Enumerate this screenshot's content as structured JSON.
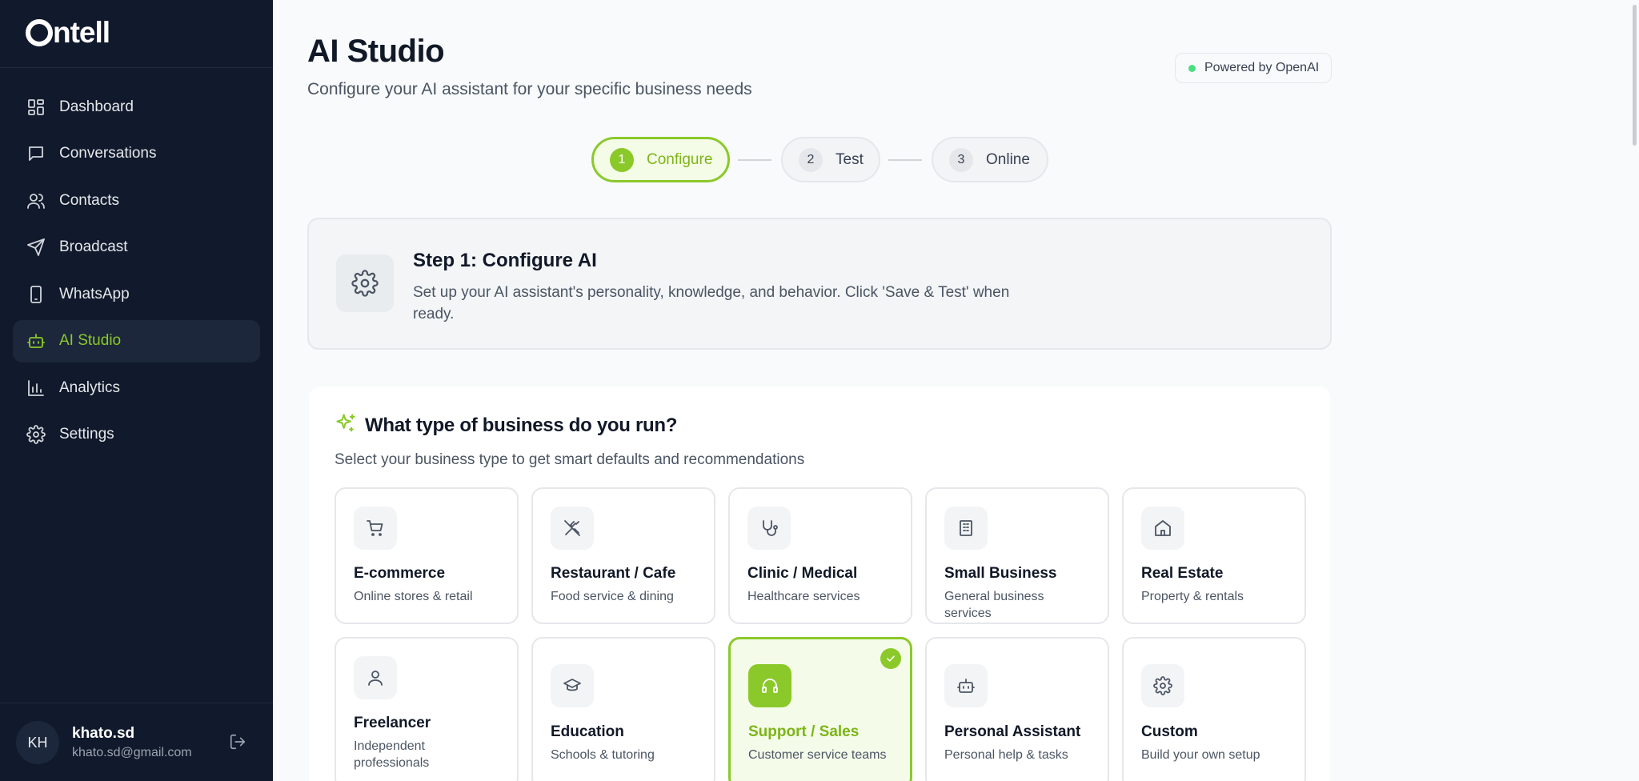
{
  "brand": {
    "name": "ntell",
    "accent": "#8bc92a",
    "sidebar_bg": "#111a2c"
  },
  "sidebar": {
    "items": [
      {
        "label": "Dashboard",
        "icon": "dashboard-icon",
        "active": false
      },
      {
        "label": "Conversations",
        "icon": "chat-bubble-icon",
        "active": false
      },
      {
        "label": "Contacts",
        "icon": "users-icon",
        "active": false
      },
      {
        "label": "Broadcast",
        "icon": "send-icon",
        "active": false
      },
      {
        "label": "WhatsApp",
        "icon": "phone-icon",
        "active": false
      },
      {
        "label": "AI Studio",
        "icon": "bot-icon",
        "active": true
      },
      {
        "label": "Analytics",
        "icon": "bar-chart-icon",
        "active": false
      },
      {
        "label": "Settings",
        "icon": "gear-icon",
        "active": false
      }
    ]
  },
  "user": {
    "initials": "KH",
    "name": "khato.sd",
    "email": "khato.sd@gmail.com",
    "logout_icon": "logout-icon"
  },
  "header": {
    "title": "AI Studio",
    "subtitle": "Configure your AI assistant for your specific business needs",
    "powered_by": "Powered by OpenAI"
  },
  "stepper": {
    "steps": [
      {
        "num": "1",
        "label": "Configure",
        "active": true
      },
      {
        "num": "2",
        "label": "Test",
        "active": false
      },
      {
        "num": "3",
        "label": "Online",
        "active": false
      }
    ]
  },
  "config_card": {
    "title": "Step 1: Configure AI",
    "description": "Set up your AI assistant's personality, knowledge, and behavior. Click 'Save & Test' when ready."
  },
  "business": {
    "title": "What type of business do you run?",
    "description": "Select your business type to get smart defaults and recommendations",
    "types": [
      {
        "name": "E-commerce",
        "sub": "Online stores & retail",
        "icon": "shopping-cart-icon",
        "selected": false
      },
      {
        "name": "Restaurant / Cafe",
        "sub": "Food service & dining",
        "icon": "utensils-icon",
        "selected": false
      },
      {
        "name": "Clinic / Medical",
        "sub": "Healthcare services",
        "icon": "stethoscope-icon",
        "selected": false
      },
      {
        "name": "Small Business",
        "sub": "General business services",
        "icon": "building-icon",
        "selected": false
      },
      {
        "name": "Real Estate",
        "sub": "Property & rentals",
        "icon": "home-icon",
        "selected": false
      },
      {
        "name": "Freelancer",
        "sub": "Independent professionals",
        "icon": "user-icon",
        "selected": false
      },
      {
        "name": "Education",
        "sub": "Schools & tutoring",
        "icon": "graduation-cap-icon",
        "selected": false
      },
      {
        "name": "Support / Sales",
        "sub": "Customer service teams",
        "icon": "headphones-icon",
        "selected": true
      },
      {
        "name": "Personal Assistant",
        "sub": "Personal help & tasks",
        "icon": "bot-icon",
        "selected": false
      },
      {
        "name": "Custom",
        "sub": "Build your own setup",
        "icon": "gear-icon",
        "selected": false
      }
    ]
  }
}
